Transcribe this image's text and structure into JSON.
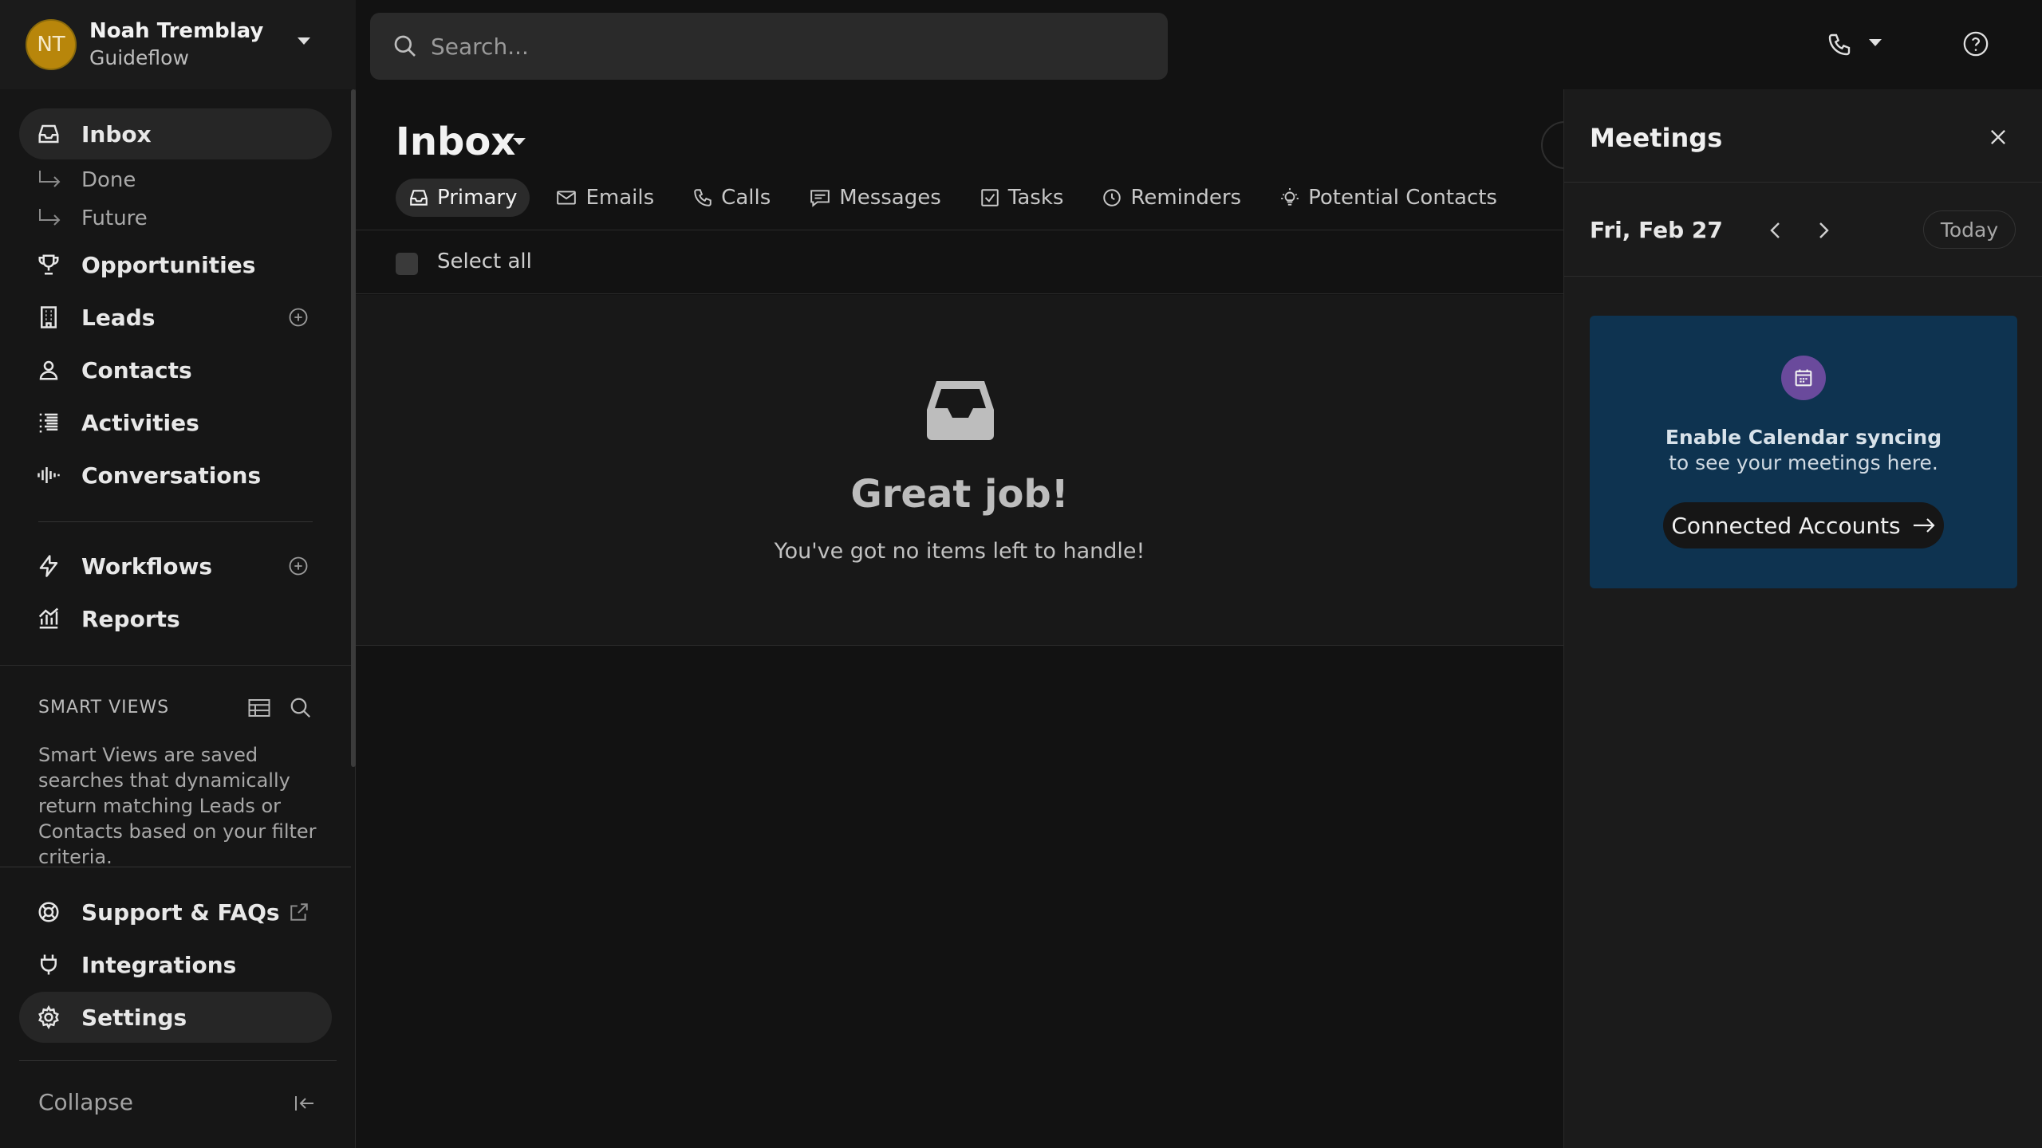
{
  "user": {
    "initials": "NT",
    "name": "Noah Tremblay",
    "org": "Guideflow"
  },
  "search": {
    "placeholder": "Search..."
  },
  "nav": {
    "inbox": "Inbox",
    "done": "Done",
    "future": "Future",
    "opportunities": "Opportunities",
    "leads": "Leads",
    "contacts": "Contacts",
    "activities": "Activities",
    "conversations": "Conversations",
    "workflows": "Workflows",
    "reports": "Reports",
    "support": "Support & FAQs",
    "integrations": "Integrations",
    "settings": "Settings",
    "collapse": "Collapse"
  },
  "smart_views": {
    "title": "SMART VIEWS",
    "description": "Smart Views are saved searches that dynamically return matching Leads or Contacts based on your filter criteria."
  },
  "main": {
    "title": "Inbox",
    "tabs": [
      {
        "label": "Primary",
        "icon": "inbox-icon"
      },
      {
        "label": "Emails",
        "icon": "mail-icon"
      },
      {
        "label": "Calls",
        "icon": "phone-icon"
      },
      {
        "label": "Messages",
        "icon": "message-icon"
      },
      {
        "label": "Tasks",
        "icon": "checkbox-icon"
      },
      {
        "label": "Reminders",
        "icon": "clock-icon"
      },
      {
        "label": "Potential Contacts",
        "icon": "lightbulb-icon"
      }
    ],
    "select_all": "Select all",
    "empty_title": "Great job!",
    "empty_subtitle": "You've got no items left to handle!"
  },
  "meetings": {
    "title": "Meetings",
    "date": "Fri, Feb 27",
    "today": "Today",
    "sync_title": "Enable Calendar syncing",
    "sync_subtitle": "to see your meetings here.",
    "sync_button": "Connected Accounts"
  },
  "colors": {
    "background": "#121212",
    "sidebar": "#161616",
    "avatar": "#b8860b",
    "sync_card": "#0e3350",
    "sync_icon": "#6a4a9c"
  }
}
